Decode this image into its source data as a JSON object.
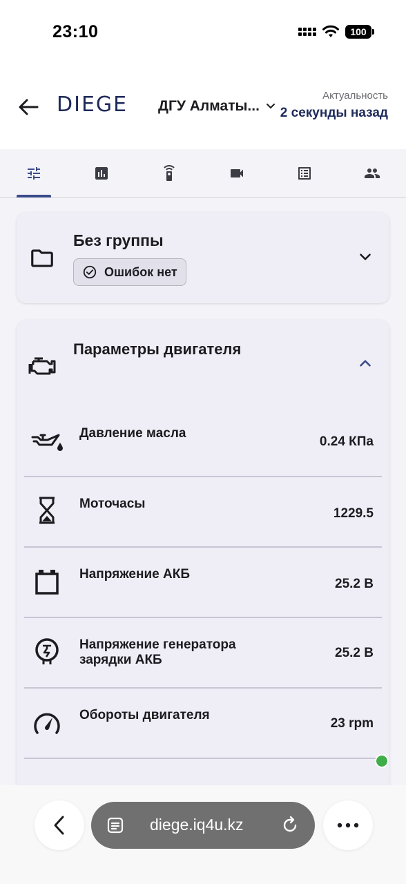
{
  "status_bar": {
    "time": "23:10",
    "battery": "100"
  },
  "header": {
    "logo": "DIEGE",
    "site_name": "ДГУ Алматы...",
    "actuality_label": "Актуальность",
    "actuality_value": "2 секунды назад",
    "brand_color": "#1e2a5a"
  },
  "tabs": [
    {
      "icon": "sliders-icon",
      "active": true
    },
    {
      "icon": "chart-icon",
      "active": false
    },
    {
      "icon": "remote-icon",
      "active": false
    },
    {
      "icon": "video-icon",
      "active": false
    },
    {
      "icon": "list-icon",
      "active": false
    },
    {
      "icon": "users-icon",
      "active": false
    }
  ],
  "group_card": {
    "title": "Без группы",
    "chip": "Ошибок нет",
    "expanded": false
  },
  "engine_card": {
    "title": "Параметры двигателя",
    "expanded": true,
    "params": [
      {
        "icon": "oil-can-icon",
        "label": "Давление масла",
        "value": "0.24 КПа"
      },
      {
        "icon": "hourglass-icon",
        "label": "Моточасы",
        "value": "1229.5"
      },
      {
        "icon": "battery-icon",
        "label": "Напряжение АКБ",
        "value": "25.2 В"
      },
      {
        "icon": "alternator-icon",
        "label": "Напряжение генератора зарядки АКБ",
        "value": "25.2 В"
      },
      {
        "icon": "speedometer-icon",
        "label": "Обороты двигателя",
        "value": "23 rpm"
      }
    ]
  },
  "status_indicator_color": "#3fae49",
  "browser": {
    "url": "diege.iq4u.kz"
  }
}
